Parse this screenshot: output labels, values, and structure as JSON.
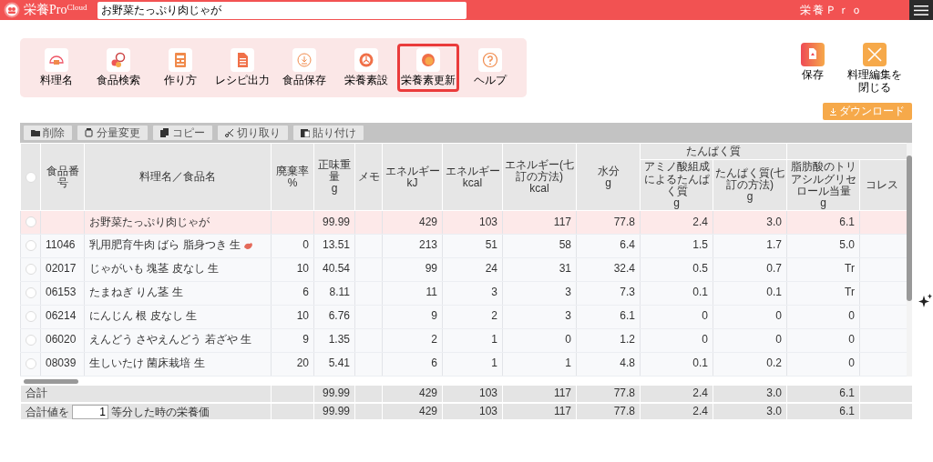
{
  "header": {
    "logo": "栄養Pro",
    "logo_badge": "Cloud",
    "search": {
      "value": "お野菜たっぷり肉じゃが"
    },
    "app_name": "栄養Ｐｒｏ"
  },
  "tools": [
    {
      "label": "料理名",
      "kind": "dish",
      "highlighted": false
    },
    {
      "label": "食品検索",
      "kind": "search",
      "highlighted": false
    },
    {
      "label": "作り方",
      "kind": "recipe",
      "highlighted": false
    },
    {
      "label": "レシピ出力",
      "kind": "export",
      "highlighted": false
    },
    {
      "label": "食品保存",
      "kind": "save",
      "highlighted": false
    },
    {
      "label": "栄養素設",
      "kind": "settings",
      "highlighted": false
    },
    {
      "label": "栄養素更新",
      "kind": "update",
      "highlighted": true
    },
    {
      "label": "ヘルプ",
      "kind": "help",
      "highlighted": false
    }
  ],
  "actions": [
    {
      "label": "保存",
      "kind": "save"
    },
    {
      "label": "料理編集を閉じる",
      "kind": "close"
    }
  ],
  "download_button": "ダウンロード",
  "table_toolbar": [
    {
      "label": "削除",
      "kind": "delete"
    },
    {
      "label": "分量変更",
      "kind": "amount"
    },
    {
      "label": "コピー",
      "kind": "copy"
    },
    {
      "label": "切り取り",
      "kind": "cut"
    },
    {
      "label": "貼り付け",
      "kind": "paste"
    }
  ],
  "table": {
    "all_selected": false,
    "columns": [
      {
        "label": "食品番号"
      },
      {
        "label": "料理名／食品名"
      },
      {
        "label": "廃棄率",
        "unit": "%"
      },
      {
        "label": "正味重量",
        "unit": "g"
      },
      {
        "label": "メモ"
      },
      {
        "label": "エネルギー",
        "unit": "kJ"
      },
      {
        "label": "エネルギー",
        "unit": "kcal"
      },
      {
        "label": "エネルギー(七訂の方法)",
        "unit": "kcal"
      },
      {
        "label": "水分",
        "unit": "g"
      },
      {
        "label": "たんぱく質",
        "children": [
          {
            "label": "アミノ酸組成によるたんぱく質",
            "unit": "g"
          },
          {
            "label": "たんぱく質(七訂の方法)",
            "unit": "g"
          }
        ]
      },
      {
        "children": [
          {
            "label": "脂肪酸のトリアシルグリセロール当量",
            "unit": "g"
          },
          {
            "label": "コレス"
          }
        ]
      }
    ],
    "rows": [
      {
        "kind": "dish",
        "selected": false,
        "name": "お野菜たっぷり肉じゃが",
        "weight": "99.99",
        "values": [
          "429",
          "103",
          "117",
          "77.8",
          "2.4",
          "3.0",
          "6.1"
        ]
      },
      {
        "kind": "food",
        "selected": false,
        "code": "11046",
        "name": "乳用肥育牛肉 ばら 脂身つき 生",
        "meat_icon": true,
        "waste": "0",
        "weight": "13.51",
        "values": [
          "213",
          "51",
          "58",
          "6.4",
          "1.5",
          "1.7",
          "5.0"
        ]
      },
      {
        "kind": "food",
        "selected": false,
        "code": "02017",
        "name": "じゃがいも 塊茎 皮なし 生",
        "waste": "10",
        "weight": "40.54",
        "values": [
          "99",
          "24",
          "31",
          "32.4",
          "0.5",
          "0.7",
          "Tr"
        ]
      },
      {
        "kind": "food",
        "selected": false,
        "code": "06153",
        "name": "たまねぎ りん茎 生",
        "waste": "6",
        "weight": "8.11",
        "values": [
          "11",
          "3",
          "3",
          "7.3",
          "0.1",
          "0.1",
          "Tr"
        ]
      },
      {
        "kind": "food",
        "selected": false,
        "code": "06214",
        "name": "にんじん 根 皮なし 生",
        "waste": "10",
        "weight": "6.76",
        "values": [
          "9",
          "2",
          "3",
          "6.1",
          "0",
          "0",
          "0"
        ]
      },
      {
        "kind": "food",
        "selected": false,
        "code": "06020",
        "name": "えんどう さやえんどう 若ざや 生",
        "waste": "9",
        "weight": "1.35",
        "values": [
          "2",
          "1",
          "0",
          "1.2",
          "0",
          "0",
          "0"
        ]
      },
      {
        "kind": "food",
        "selected": false,
        "code": "08039",
        "name": "生しいたけ 菌床栽培 生",
        "waste": "20",
        "weight": "5.41",
        "values": [
          "6",
          "1",
          "1",
          "4.8",
          "0.1",
          "0.2",
          "0"
        ]
      }
    ],
    "footer": [
      {
        "label": "合計",
        "weight": "99.99",
        "values": [
          "429",
          "103",
          "117",
          "77.8",
          "2.4",
          "3.0",
          "6.1"
        ]
      },
      {
        "label": "合計値を",
        "divisor": "1",
        "label_after": "等分した時の栄養価",
        "weight": "99.99",
        "values": [
          "429",
          "103",
          "117",
          "77.8",
          "2.4",
          "3.0",
          "6.1"
        ]
      }
    ]
  }
}
